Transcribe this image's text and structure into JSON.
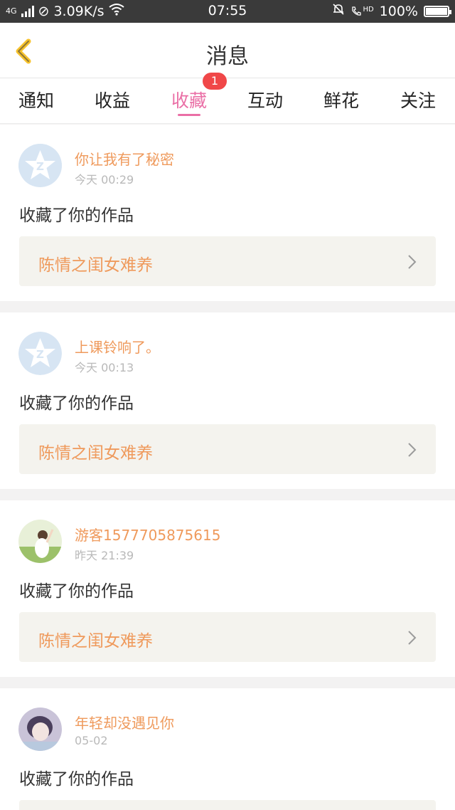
{
  "status_bar": {
    "network": "4G",
    "speed": "3.09K/s",
    "time": "07:55",
    "hd": "HD",
    "battery": "100%"
  },
  "header": {
    "title": "消息"
  },
  "tabs": [
    {
      "label": "通知"
    },
    {
      "label": "收益"
    },
    {
      "label": "收藏",
      "active": true,
      "badge": "1"
    },
    {
      "label": "互动"
    },
    {
      "label": "鲜花"
    },
    {
      "label": "关注"
    }
  ],
  "messages": [
    {
      "user": "你让我有了秘密",
      "time": "今天 00:29",
      "action": "收藏了你的作品",
      "work": "陈情之闺女难养",
      "avatar": "default-star"
    },
    {
      "user": "上课铃响了。",
      "time": "今天 00:13",
      "action": "收藏了你的作品",
      "work": "陈情之闺女难养",
      "avatar": "default-star"
    },
    {
      "user": "游客1577705875615",
      "time": "昨天 21:39",
      "action": "收藏了你的作品",
      "work": "陈情之闺女难养",
      "avatar": "photo-girl"
    },
    {
      "user": "年轻却没遇见你",
      "time": "05-02",
      "action": "收藏了你的作品",
      "work": "",
      "avatar": "photo-portrait"
    }
  ],
  "colors": {
    "accent": "#ea6fa6",
    "username": "#ef9a5c",
    "badge": "#f04748",
    "back_arrow": "#f6c22d"
  }
}
